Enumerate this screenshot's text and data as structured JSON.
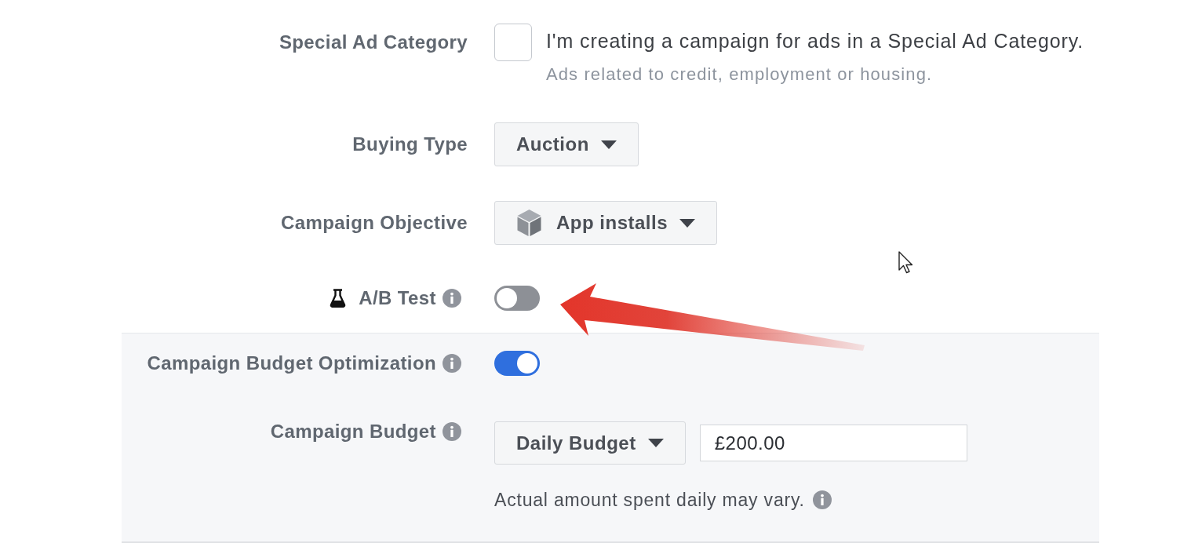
{
  "rows": [
    {
      "kind": "checkbox",
      "label": "Special Ad Category",
      "info": false,
      "checked": false,
      "text": "I'm creating a campaign for ads in a Special Ad Category.",
      "hint": "Ads related to credit, employment or housing."
    },
    {
      "kind": "dropdown",
      "label": "Buying Type",
      "info": false,
      "icon": false,
      "value": "Auction"
    },
    {
      "kind": "dropdown",
      "label": "Campaign Objective",
      "info": false,
      "icon": true,
      "value": "App installs"
    },
    {
      "kind": "toggle",
      "label": "A/B Test",
      "info": true,
      "icon": true,
      "on": false
    }
  ],
  "budget_panel": {
    "rows": [
      {
        "kind": "toggle",
        "label": "Campaign Budget Optimization",
        "info": true,
        "icon": false,
        "on": true
      },
      {
        "kind": "budget",
        "label": "Campaign Budget",
        "info": true,
        "budget_type": "Daily Budget",
        "amount": "£200.00",
        "note": "Actual amount spent daily may vary."
      }
    ]
  }
}
